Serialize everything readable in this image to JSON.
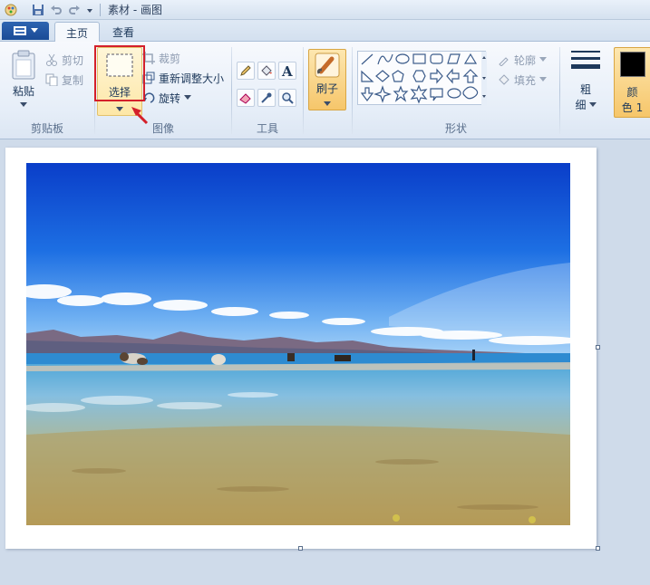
{
  "window": {
    "title": "素材 - 画图"
  },
  "tabs": [
    {
      "label": "主页"
    },
    {
      "label": "查看"
    }
  ],
  "clipboard": {
    "paste_label": "粘贴",
    "cut_label": "剪切",
    "copy_label": "复制",
    "group_label": "剪贴板"
  },
  "image": {
    "select_label": "选择",
    "crop_label": "裁剪",
    "resize_label": "重新调整大小",
    "rotate_label": "旋转",
    "group_label": "图像"
  },
  "tools": {
    "group_label": "工具",
    "icons": [
      "pencil-icon",
      "fill-icon",
      "text-icon",
      "eraser-icon",
      "color-picker-icon",
      "magnifier-icon"
    ]
  },
  "brushes": {
    "label": "刷子"
  },
  "shapes": {
    "outline_label": "轮廓",
    "fill_label": "填充",
    "group_label": "形状"
  },
  "size": {
    "label_line1": "粗",
    "label_line2": "细"
  },
  "color1": {
    "label_line1": "颜",
    "label_line2": "色 1",
    "value": "#000000"
  },
  "colors": {
    "ribbon_bg": "#e6eef8",
    "highlight": "#d4202a",
    "accent_brush": "#f6c66a"
  }
}
